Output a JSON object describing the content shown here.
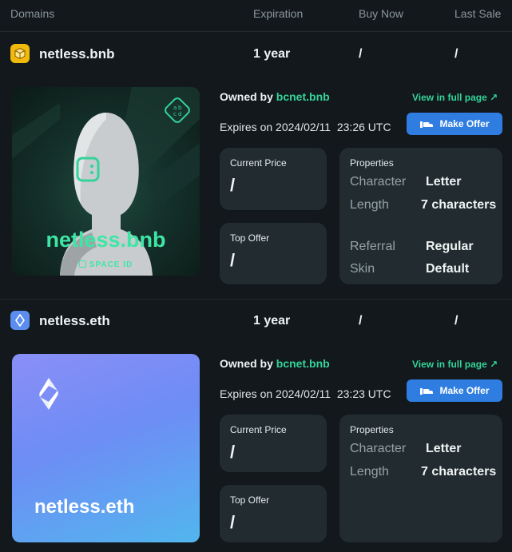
{
  "header": {
    "col_domains": "Domains",
    "col_expiration": "Expiration",
    "col_buy_now": "Buy Now",
    "col_last_sale": "Last Sale"
  },
  "domains": [
    {
      "name": "netless.bnb",
      "icon": "bnb-cube-icon",
      "expiration": "1 year",
      "buy_now": "/",
      "last_sale": "/",
      "image_text": "netless.bnb",
      "image_brand": "SPACE ID",
      "image_badge": "a b c d",
      "owned_by_label": "Owned by",
      "owner": "bcnet.bnb",
      "view_link": "View in full page",
      "expires_label": "Expires on",
      "expires_value": "2024/02/11  23:26 UTC",
      "make_offer": "Make Offer",
      "current_price_label": "Current Price",
      "current_price": "/",
      "top_offer_label": "Top Offer",
      "top_offer": "/",
      "properties_title": "Properties",
      "properties": [
        {
          "key": "Character",
          "value": "Letter"
        },
        {
          "key": "Length",
          "value": "7 characters"
        },
        {
          "key": "Referral",
          "value": "Regular"
        },
        {
          "key": "Skin",
          "value": "Default"
        }
      ]
    },
    {
      "name": "netless.eth",
      "icon": "eth-diamond-icon",
      "expiration": "1 year",
      "buy_now": "/",
      "last_sale": "/",
      "image_text": "netless.eth",
      "owned_by_label": "Owned by",
      "owner": "bcnet.bnb",
      "view_link": "View in full page",
      "expires_label": "Expires on",
      "expires_value": "2024/02/11  23:23 UTC",
      "make_offer": "Make Offer",
      "current_price_label": "Current Price",
      "current_price": "/",
      "top_offer_label": "Top Offer",
      "top_offer": "/",
      "properties_title": "Properties",
      "properties": [
        {
          "key": "Character",
          "value": "Letter"
        },
        {
          "key": "Length",
          "value": "7 characters"
        }
      ]
    }
  ],
  "colors": {
    "background": "#12181b",
    "card": "#222c30",
    "accent_green": "#34d399",
    "button_blue": "#2f7de1"
  }
}
